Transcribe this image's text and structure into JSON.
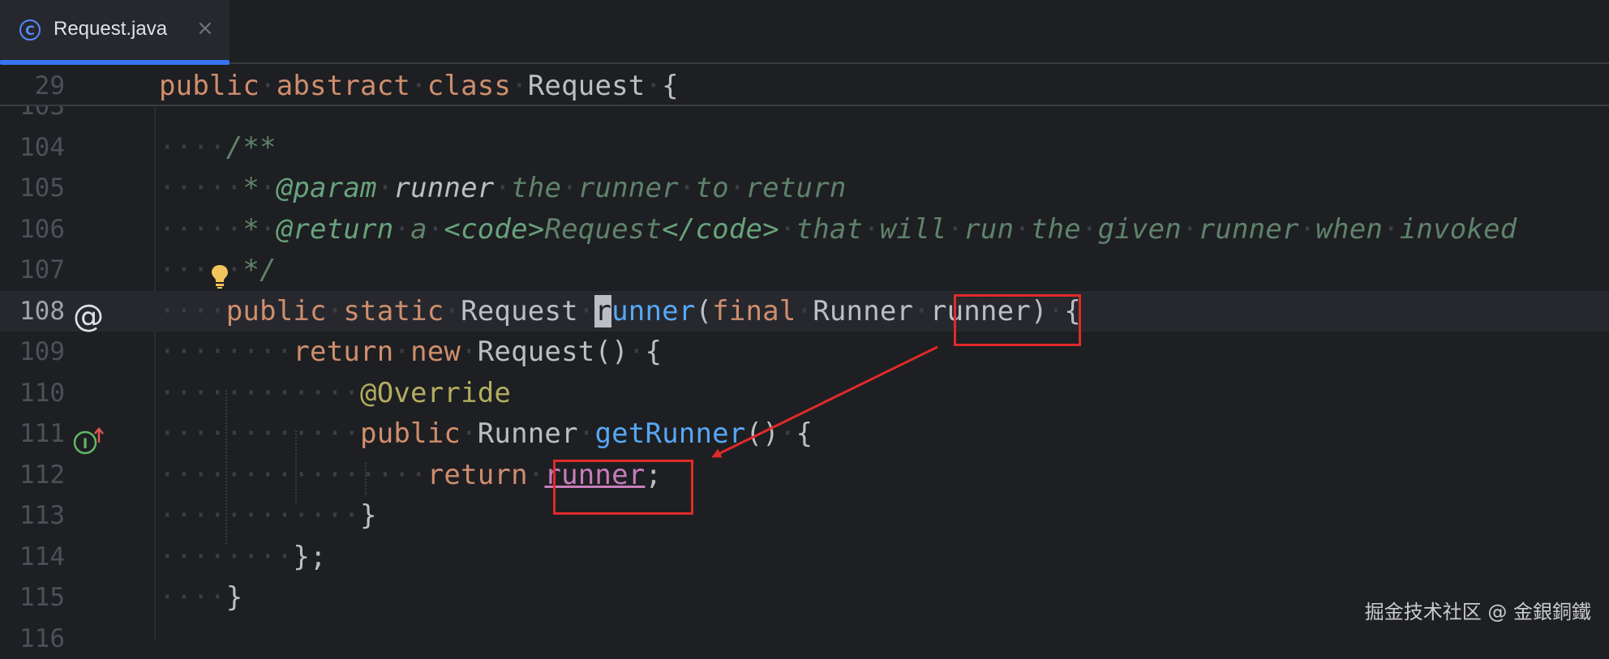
{
  "tab": {
    "icon": "class-icon",
    "title": "Request.java",
    "close": "×"
  },
  "sticky": {
    "line_number": "29",
    "code": [
      {
        "t": "public",
        "c": "kw"
      },
      {
        "t": "·",
        "c": "ws"
      },
      {
        "t": "abstract",
        "c": "kw"
      },
      {
        "t": "·",
        "c": "ws"
      },
      {
        "t": "class",
        "c": "kw"
      },
      {
        "t": "·",
        "c": "ws"
      },
      {
        "t": "Request"
      },
      {
        "t": "·",
        "c": "ws"
      },
      {
        "t": "{"
      }
    ]
  },
  "lines": [
    {
      "n": "103",
      "code": []
    },
    {
      "n": "104",
      "code": [
        {
          "t": "····",
          "c": "ws"
        },
        {
          "t": "/**",
          "c": "cmt"
        }
      ]
    },
    {
      "n": "105",
      "code": [
        {
          "t": "·····",
          "c": "ws"
        },
        {
          "t": "*",
          "c": "cmt"
        },
        {
          "t": "·",
          "c": "ws"
        },
        {
          "t": "@param",
          "c": "tag"
        },
        {
          "t": "·",
          "c": "ws"
        },
        {
          "t": "runner",
          "c": "doc-param"
        },
        {
          "t": "·",
          "c": "ws"
        },
        {
          "t": "the",
          "c": "cmt"
        },
        {
          "t": "·",
          "c": "ws"
        },
        {
          "t": "runner",
          "c": "cmt"
        },
        {
          "t": "·",
          "c": "ws"
        },
        {
          "t": "to",
          "c": "cmt"
        },
        {
          "t": "·",
          "c": "ws"
        },
        {
          "t": "return",
          "c": "cmt"
        }
      ]
    },
    {
      "n": "106",
      "code": [
        {
          "t": "·····",
          "c": "ws"
        },
        {
          "t": "*",
          "c": "cmt"
        },
        {
          "t": "·",
          "c": "ws"
        },
        {
          "t": "@return",
          "c": "tag"
        },
        {
          "t": "·",
          "c": "ws"
        },
        {
          "t": "a",
          "c": "cmt"
        },
        {
          "t": "·",
          "c": "ws"
        },
        {
          "t": "<code>",
          "c": "tag"
        },
        {
          "t": "Request",
          "c": "cmt"
        },
        {
          "t": "</code>",
          "c": "tag"
        },
        {
          "t": "·",
          "c": "ws"
        },
        {
          "t": "that",
          "c": "cmt"
        },
        {
          "t": "·",
          "c": "ws"
        },
        {
          "t": "will",
          "c": "cmt"
        },
        {
          "t": "·",
          "c": "ws"
        },
        {
          "t": "run",
          "c": "cmt"
        },
        {
          "t": "·",
          "c": "ws"
        },
        {
          "t": "the",
          "c": "cmt"
        },
        {
          "t": "·",
          "c": "ws"
        },
        {
          "t": "given",
          "c": "cmt"
        },
        {
          "t": "·",
          "c": "ws"
        },
        {
          "t": "runner",
          "c": "cmt"
        },
        {
          "t": "·",
          "c": "ws"
        },
        {
          "t": "when",
          "c": "cmt"
        },
        {
          "t": "·",
          "c": "ws"
        },
        {
          "t": "invoked",
          "c": "cmt"
        }
      ]
    },
    {
      "n": "107",
      "code": [
        {
          "t": "·····",
          "c": "ws"
        },
        {
          "t": "*/",
          "c": "cmt"
        }
      ]
    },
    {
      "n": "108",
      "current": true,
      "code": [
        {
          "t": "····",
          "c": "ws"
        },
        {
          "t": "public",
          "c": "kw"
        },
        {
          "t": "·",
          "c": "ws"
        },
        {
          "t": "static",
          "c": "kw"
        },
        {
          "t": "·",
          "c": "ws"
        },
        {
          "t": "Request"
        },
        {
          "t": "·",
          "c": "ws"
        },
        {
          "t": "r",
          "c": "caret"
        },
        {
          "t": "unner",
          "c": "fn"
        },
        {
          "t": "("
        },
        {
          "t": "final",
          "c": "kw"
        },
        {
          "t": "·",
          "c": "ws"
        },
        {
          "t": "Runner"
        },
        {
          "t": "·",
          "c": "ws"
        },
        {
          "t": "runner"
        },
        {
          "t": ")"
        },
        {
          "t": "·",
          "c": "ws"
        },
        {
          "t": "{"
        }
      ]
    },
    {
      "n": "109",
      "code": [
        {
          "t": "········",
          "c": "ws"
        },
        {
          "t": "return",
          "c": "kw"
        },
        {
          "t": "·",
          "c": "ws"
        },
        {
          "t": "new",
          "c": "kw"
        },
        {
          "t": "·",
          "c": "ws"
        },
        {
          "t": "Request"
        },
        {
          "t": "()"
        },
        {
          "t": "·",
          "c": "ws"
        },
        {
          "t": "{"
        }
      ]
    },
    {
      "n": "110",
      "code": [
        {
          "t": "············",
          "c": "ws"
        },
        {
          "t": "@Override",
          "c": "ann"
        }
      ]
    },
    {
      "n": "111",
      "code": [
        {
          "t": "············",
          "c": "ws"
        },
        {
          "t": "public",
          "c": "kw"
        },
        {
          "t": "·",
          "c": "ws"
        },
        {
          "t": "Runner"
        },
        {
          "t": "·",
          "c": "ws"
        },
        {
          "t": "getRunner",
          "c": "fn"
        },
        {
          "t": "()"
        },
        {
          "t": "·",
          "c": "ws"
        },
        {
          "t": "{"
        }
      ]
    },
    {
      "n": "112",
      "code": [
        {
          "t": "················",
          "c": "ws"
        },
        {
          "t": "return",
          "c": "kw"
        },
        {
          "t": "·",
          "c": "ws"
        },
        {
          "t": "runner",
          "c": "field"
        },
        {
          "t": ";"
        }
      ]
    },
    {
      "n": "113",
      "code": [
        {
          "t": "············",
          "c": "ws"
        },
        {
          "t": "}"
        }
      ]
    },
    {
      "n": "114",
      "code": [
        {
          "t": "········",
          "c": "ws"
        },
        {
          "t": "};"
        }
      ]
    },
    {
      "n": "115",
      "code": [
        {
          "t": "····",
          "c": "ws"
        },
        {
          "t": "}"
        }
      ]
    },
    {
      "n": "116",
      "code": []
    }
  ],
  "gutter": {
    "line108_icon": "@",
    "line108_icon_name": "at-sign-implementation-icon",
    "line111_icon_name": "implements-method-icon",
    "line107_icon_name": "lightbulb-intention-icon"
  },
  "annotation": {
    "box_color": "#e02a2a",
    "arrow_color": "#e02a2a"
  },
  "watermark": "掘金技术社区 @ 金銀銅鐵"
}
